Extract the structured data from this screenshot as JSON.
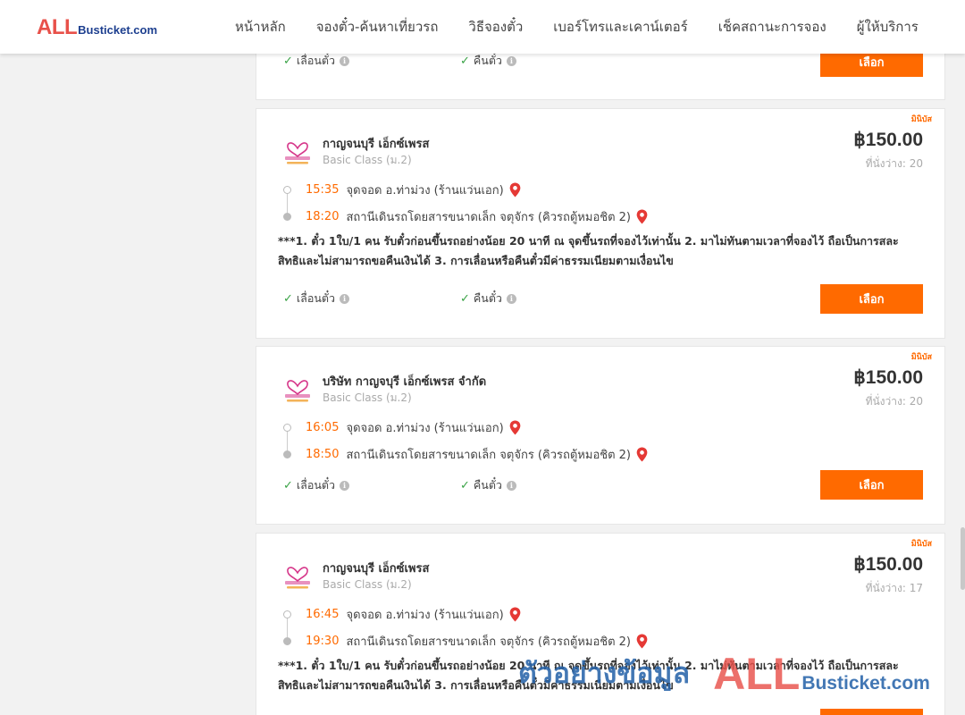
{
  "header": {
    "logo_all": "ALL",
    "logo_rest": "Busticket.com",
    "nav": [
      "หน้าหลัก",
      "จองตั๋ว-ค้นหาเที่ยวรถ",
      "วิธีจองตั๋ว",
      "เบอร์โทรและเคาน์เตอร์",
      "เช็คสถานะการจอง",
      "ผู้ให้บริการ"
    ]
  },
  "features": {
    "reschedule": "เลื่อนตั๋ว",
    "refund": "คืนตั๋ว"
  },
  "select_label": "เลือก",
  "cards": [
    {
      "badge": "มินิบัส",
      "operator": "กาญจนบุรี เอ็กซ์เพรส",
      "class": "Basic Class (ม.2)",
      "price": "฿150.00",
      "seats": "ที่นั่งว่าง: 20",
      "depart_time": "15:35",
      "depart_place": "จุดจอด อ.ท่าม่วง (ร้านแว่นเอก)",
      "arrive_time": "18:20",
      "arrive_place": "สถานีเดินรถโดยสารขนาดเล็ก จตุจักร (คิวรถตู้หมอชิต 2)",
      "note": "***1. ตั๋ว 1ใบ/1 คน รับตั๋วก่อนขึ้นรถอย่างน้อย 20 นาที ณ จุดขึ้นรถที่จองไว้เท่านั้น 2. มาไม่ทันตามเวลาที่จองไว้ ถือเป็นการสละสิทธิและไม่สามารถขอคืนเงินได้ 3. การเลื่อนหรือคืนตั๋วมีค่าธรรมเนียมตามเงื่อนไข"
    },
    {
      "badge": "มินิบัส",
      "operator": "บริษัท กาญจบุรี เอ็กซ์เพรส จำกัด",
      "class": "Basic Class (ม.2)",
      "price": "฿150.00",
      "seats": "ที่นั่งว่าง: 20",
      "depart_time": "16:05",
      "depart_place": "จุดจอด อ.ท่าม่วง (ร้านแว่นเอก)",
      "arrive_time": "18:50",
      "arrive_place": "สถานีเดินรถโดยสารขนาดเล็ก จตุจักร (คิวรถตู้หมอชิต 2)"
    },
    {
      "badge": "มินิบัส",
      "operator": "กาญจนบุรี เอ็กซ์เพรส",
      "class": "Basic Class (ม.2)",
      "price": "฿150.00",
      "seats": "ที่นั่งว่าง: 17",
      "depart_time": "16:45",
      "depart_place": "จุดจอด อ.ท่าม่วง (ร้านแว่นเอก)",
      "arrive_time": "19:30",
      "arrive_place": "สถานีเดินรถโดยสารขนาดเล็ก จตุจักร (คิวรถตู้หมอชิต 2)",
      "note": "***1. ตั๋ว 1ใบ/1 คน รับตั๋วก่อนขึ้นรถอย่างน้อย 20 นาที ณ จุดขึ้นรถที่จองไว้เท่านั้น 2. มาไม่ทันตามเวลาที่จองไว้ ถือเป็นการสละสิทธิและไม่สามารถขอคืนเงินได้ 3. การเลื่อนหรือคืนตั๋วมีค่าธรรมเนียมตามเงื่อนไข"
    }
  ],
  "watermark": {
    "text": "ตัวอย่างข้อมูล",
    "all": "ALL",
    "rest": "Busticket.com"
  },
  "colors": {
    "accent": "#ff6a00",
    "check": "#3aa346",
    "pin": "#e53935",
    "logo_red": "#e8514a",
    "logo_blue": "#1d3f8f"
  }
}
